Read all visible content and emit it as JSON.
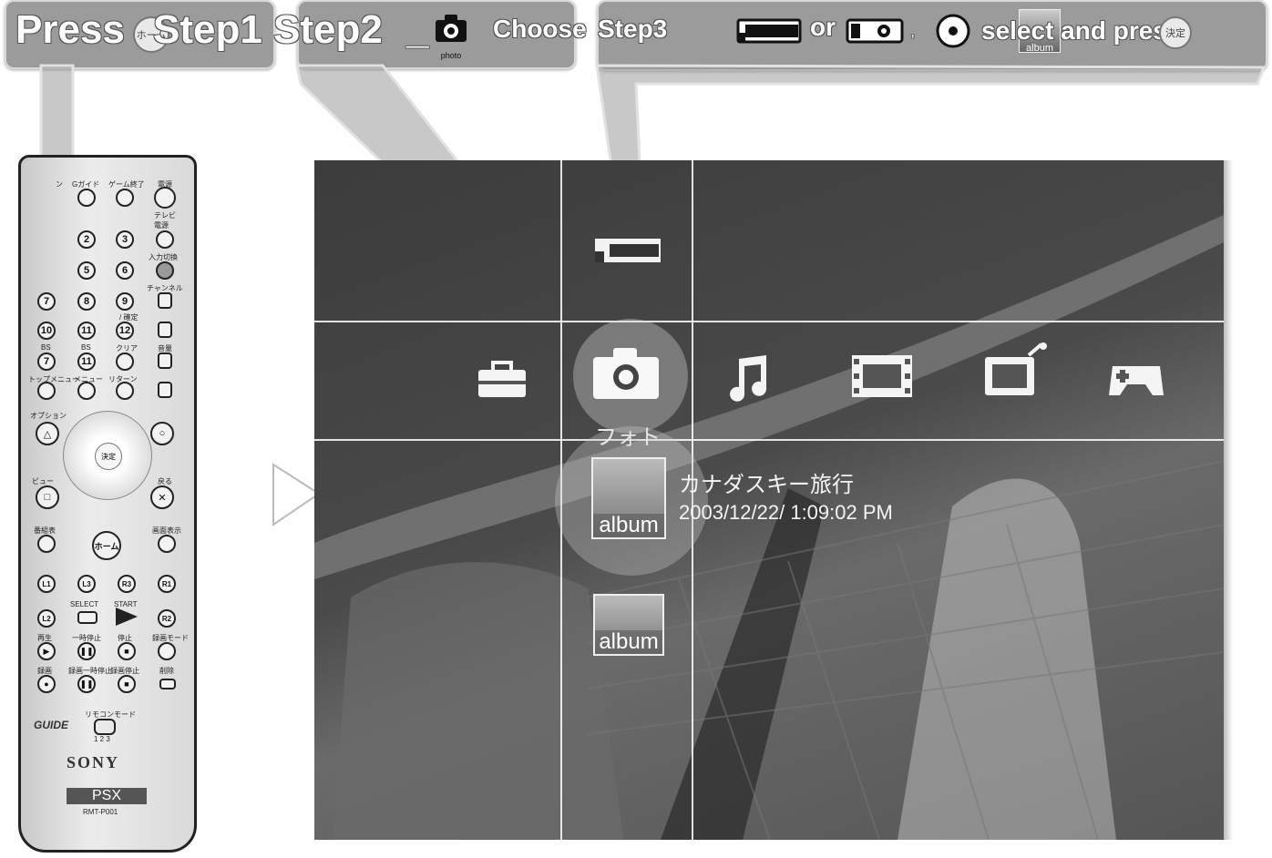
{
  "banner": {
    "press_label": "Press",
    "home_button_label": "ホーム",
    "step1_label": "Step1",
    "step2_label": "Step2",
    "step2_dash": "_",
    "photo_icon_label": "photo",
    "choose_label": "Choose",
    "step3_label": "Step3",
    "or_label": "or",
    "album_icon_label": "album",
    "select_and_press_label": "select and press",
    "enter_button_label": "決定"
  },
  "remote": {
    "top_labels": [
      "ン",
      "Gガイド",
      "ゲーム終了",
      "電源"
    ],
    "tv_power_label": "テレビ\n電源",
    "input_label": "入力切換",
    "channel_label": "チャンネル",
    "volume_label": "音量",
    "number_keys": [
      "2",
      "3",
      "5",
      "6",
      "7",
      "8",
      "9",
      "10",
      "11",
      "12",
      "7",
      "11"
    ],
    "decide_label": "/ 確定",
    "clear_label": "クリア",
    "bs_labels": [
      "BS",
      "BS"
    ],
    "top_menu_label": "トップメニュー",
    "menu_label": "メニュー",
    "return_label": "リターン",
    "option_label": "オプション",
    "view_label": "ビュー",
    "back_label": "戻る",
    "dpad_center_label": "決定",
    "program_list_label": "番組表",
    "screen_display_label": "画面表示",
    "home_label": "ホーム",
    "l1": "L1",
    "l3": "L3",
    "r3": "R3",
    "r1": "R1",
    "l2": "L2",
    "r2": "R2",
    "select_label": "SELECT",
    "start_label": "START",
    "play_label": "再生",
    "pause_label": "一時停止",
    "stop_label": "停止",
    "rec_mode_label": "録画モード",
    "rec_label": "録画",
    "rec_pause_label": "録画一時停止",
    "rec_stop_label": "録画停止",
    "delete_label": "削除",
    "remote_mode_label": "リモコンモード",
    "remote_mode_nums": "1 2 3",
    "guide_logo": "GUIDE",
    "brand": "SONY",
    "model_badge": "PSX",
    "model_number": "RMT-P001"
  },
  "screen": {
    "category_label": "フォト",
    "selected_item": {
      "badge": "album",
      "title": "カナダスキー旅行",
      "date": "2003/12/22/ 1:09:02 PM"
    },
    "next_item_badge": "album",
    "categories": [
      "settings-icon",
      "photo-icon",
      "music-icon",
      "video-icon",
      "tv-icon",
      "game-icon"
    ]
  },
  "colors": {
    "callout_bg": "#9b9b9b",
    "screen_bg": "#404040",
    "highlight": "#ffffff"
  }
}
